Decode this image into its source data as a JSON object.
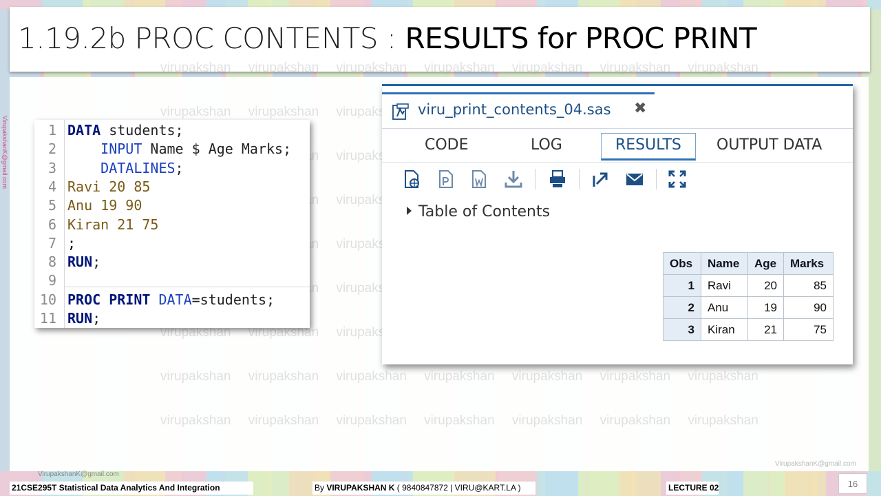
{
  "slide": {
    "title_light": "1.19.2b PROC CONTENTS : ",
    "title_bold": "RESULTS for PROC PRINT",
    "watermark_text": "virupakshan",
    "side_email": "VirupakshanK@gmail.com"
  },
  "code": {
    "lines": [
      {
        "n": "1",
        "parts": [
          [
            "kw",
            "DATA"
          ],
          [
            "id",
            " students;"
          ]
        ]
      },
      {
        "n": "2",
        "parts": [
          [
            "id",
            "    "
          ],
          [
            "kw2",
            "INPUT"
          ],
          [
            "id",
            " Name $ Age Marks;"
          ]
        ]
      },
      {
        "n": "3",
        "parts": [
          [
            "id",
            "    "
          ],
          [
            "kw2",
            "DATALINES"
          ],
          [
            "id",
            ";"
          ]
        ]
      },
      {
        "n": "4",
        "parts": [
          [
            "dl",
            "Ravi 20 85"
          ]
        ]
      },
      {
        "n": "5",
        "parts": [
          [
            "dl",
            "Anu 19 90"
          ]
        ]
      },
      {
        "n": "6",
        "parts": [
          [
            "dl",
            "Kiran 21 75"
          ]
        ]
      },
      {
        "n": "7",
        "parts": [
          [
            "sym",
            ";"
          ]
        ]
      },
      {
        "n": "8",
        "parts": [
          [
            "kw",
            "RUN"
          ],
          [
            "id",
            ";"
          ]
        ]
      },
      {
        "n": "9",
        "parts": []
      },
      {
        "n": "10",
        "parts": [
          [
            "kw",
            "PROC PRINT"
          ],
          [
            "id",
            " "
          ],
          [
            "kw2",
            "DATA"
          ],
          [
            "id",
            "=students;"
          ]
        ]
      },
      {
        "n": "11",
        "parts": [
          [
            "kw",
            "RUN"
          ],
          [
            "id",
            ";"
          ]
        ]
      }
    ]
  },
  "sas": {
    "file_name": "viru_print_contents_04.sas",
    "close_glyph": "✖",
    "tabs": [
      {
        "label": "CODE",
        "active": false
      },
      {
        "label": "LOG",
        "active": false
      },
      {
        "label": "RESULTS",
        "active": true
      },
      {
        "label": "OUTPUT DATA",
        "active": false
      }
    ],
    "toolbar_icons": [
      "open-html-icon",
      "pdf-icon",
      "rtf-icon",
      "download-icon",
      "print-icon",
      "popout-icon",
      "email-icon",
      "expand-icon"
    ],
    "toc_label": "Table of Contents",
    "table": {
      "headers": [
        "Obs",
        "Name",
        "Age",
        "Marks"
      ],
      "rows": [
        [
          "1",
          "Ravi",
          "20",
          "85"
        ],
        [
          "2",
          "Anu",
          "19",
          "90"
        ],
        [
          "3",
          "Kiran",
          "21",
          "75"
        ]
      ]
    },
    "accent_color": "#2d6fb4"
  },
  "footer": {
    "email_left": "VirupakshanK@gmail.com",
    "email_right": "VirupakshanK@gmail.com",
    "course": "21CSE295T Statistical Data Analytics And Integration",
    "author_prefix": "By ",
    "author_name": "VIRUPAKSHAN K",
    "author_suffix": " ( 9840847872 | VIRU@KART.LA )",
    "lecture": "LECTURE 02",
    "page": "16"
  }
}
